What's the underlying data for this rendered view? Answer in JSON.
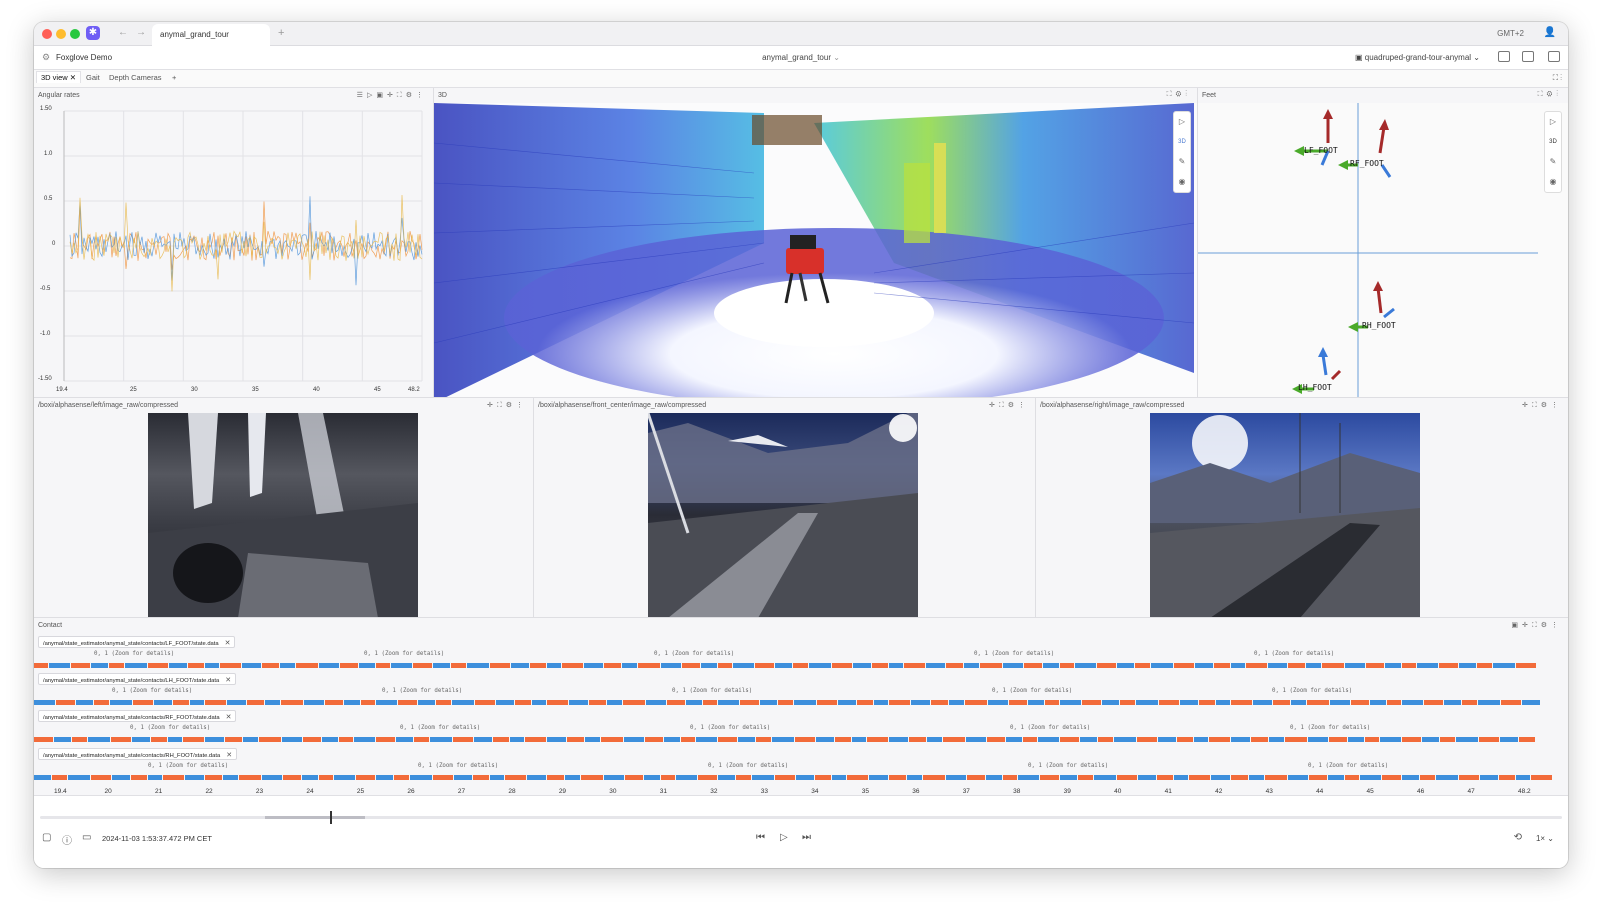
{
  "browser": {
    "tab_title": "anymal_grand_tour",
    "timezone": "GMT+2"
  },
  "app": {
    "org": "Foxglove Demo",
    "source": "anymal_grand_tour",
    "layout": "quadruped-grand-tour-anymal"
  },
  "workspace_tabs": [
    "3D view",
    "Gait",
    "Depth Cameras"
  ],
  "panels": {
    "angular_rates": {
      "title": "Angular rates",
      "y_ticks": [
        "1.50",
        "1.0",
        "0.5",
        "0",
        "-0.5",
        "-1.0",
        "-1.50"
      ],
      "x_ticks": [
        "19.4",
        "25",
        "30",
        "35",
        "40",
        "45",
        "48.2"
      ]
    },
    "scene3d": {
      "title": "3D"
    },
    "feet": {
      "title": "Feet",
      "labels": [
        "LF_FOOT",
        "RF_FOOT",
        "RH_FOOT",
        "LH_FOOT"
      ]
    },
    "cameras": [
      {
        "title": "/boxi/alphasense/left/image_raw/compressed"
      },
      {
        "title": "/boxi/alphasense/front_center/image_raw/compressed"
      },
      {
        "title": "/boxi/alphasense/right/image_raw/compressed"
      }
    ],
    "contact": {
      "title": "Contact",
      "series": [
        "/anymal/state_estimator/anymal_state/contacts/LF_FOOT/state.data",
        "/anymal/state_estimator/anymal_state/contacts/LH_FOOT/state.data",
        "/anymal/state_estimator/anymal_state/contacts/RF_FOOT/state.data",
        "/anymal/state_estimator/anymal_state/contacts/RH_FOOT/state.data"
      ],
      "detail_label": "0, 1 (Zoom for details)",
      "x_ticks": [
        "19.4",
        "20",
        "21",
        "22",
        "23",
        "24",
        "25",
        "26",
        "27",
        "28",
        "29",
        "30",
        "31",
        "32",
        "33",
        "34",
        "35",
        "36",
        "37",
        "38",
        "39",
        "40",
        "41",
        "42",
        "43",
        "44",
        "45",
        "46",
        "47",
        "48.2"
      ]
    }
  },
  "playback": {
    "timestamp": "2024-11-03 1:53:37.472 PM CET",
    "speed": "1×"
  },
  "colors": {
    "accent": "#6f5ef5",
    "contact_on": "#f26b3a",
    "contact_off": "#3d8fdc",
    "plot_orange": "#f0913a",
    "plot_blue": "#4a90d9"
  }
}
